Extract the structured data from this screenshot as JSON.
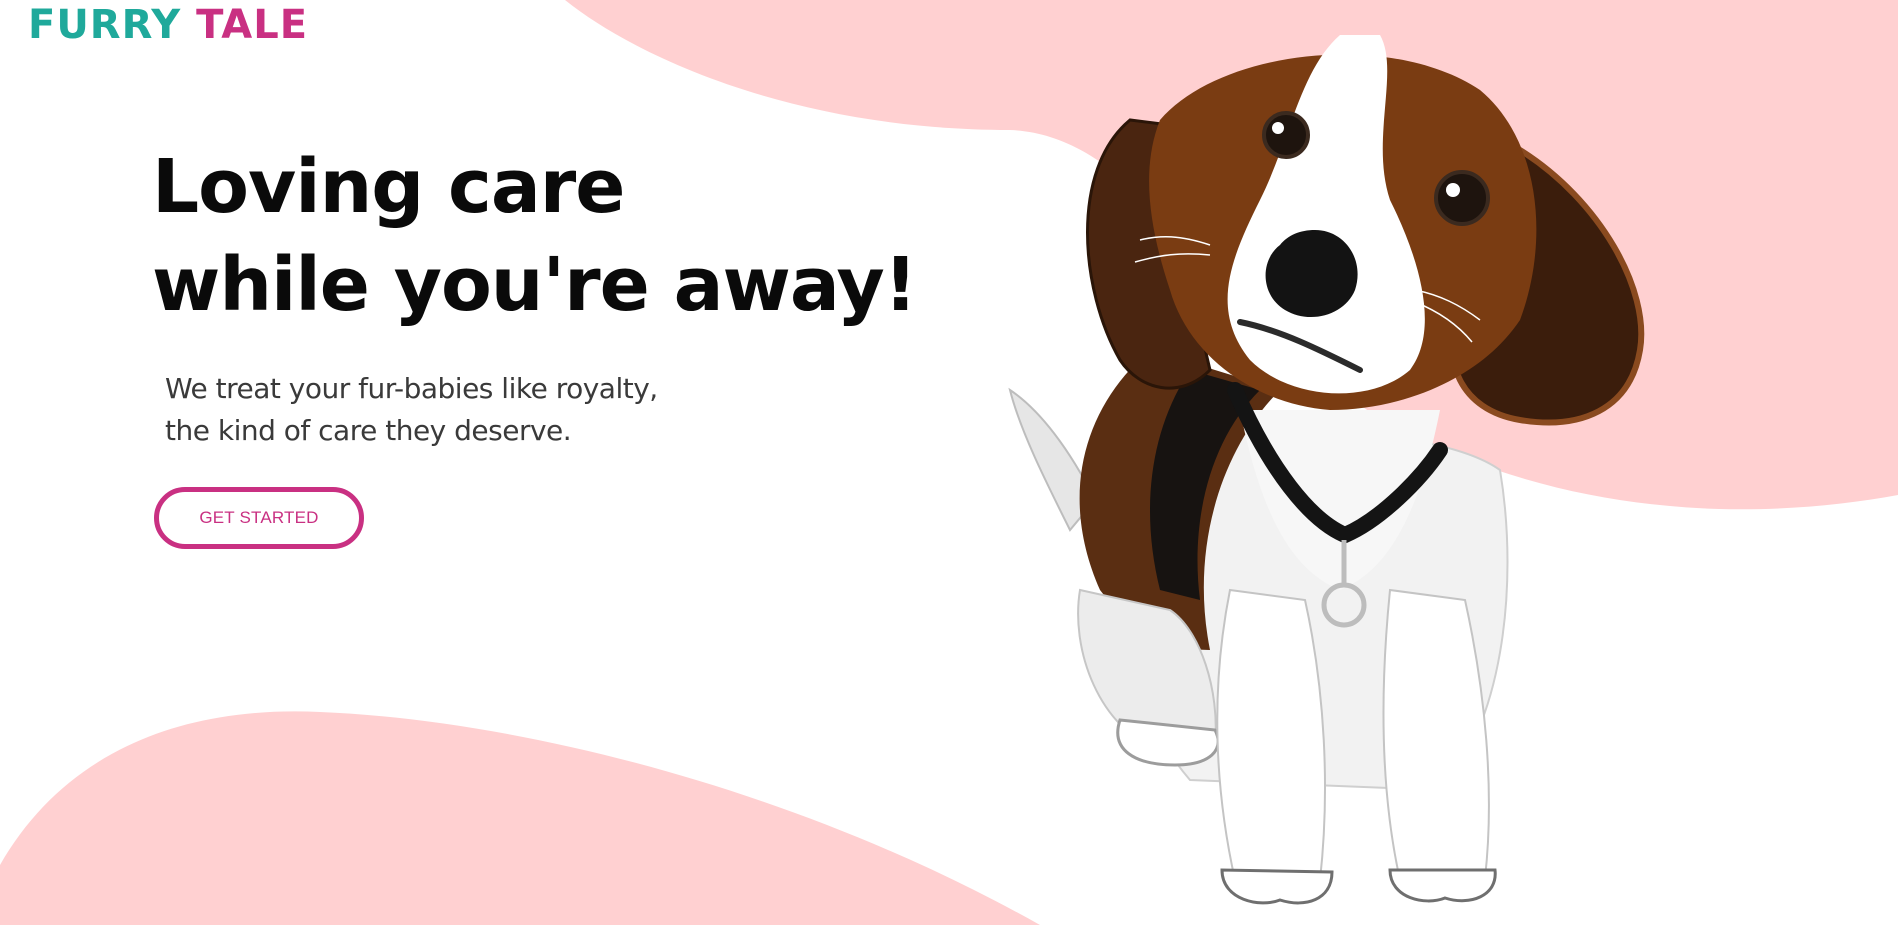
{
  "brand": {
    "word1": "FURRY",
    "word2": "TALE"
  },
  "hero": {
    "headline_line1": "Loving care",
    "headline_line2": "while you're away!",
    "subtext_line1": "We treat your fur-babies like royalty,",
    "subtext_line2": "the kind of care they deserve.",
    "cta_label": "GET STARTED"
  },
  "theme": {
    "brand_teal": "#1fa99b",
    "brand_pink": "#c93082",
    "blob_pink": "#ffd0d1",
    "heading_color": "#0a0a0a",
    "body_text_color": "#3a3a3a"
  },
  "illustration": {
    "icon": "beagle-puppy-illustration"
  }
}
